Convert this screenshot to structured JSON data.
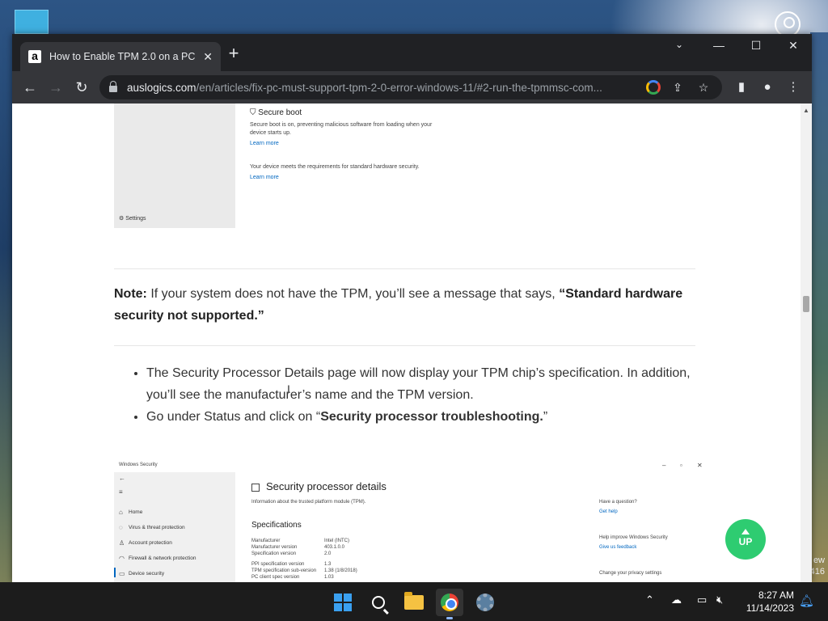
{
  "browser": {
    "tab_title": "How to Enable TPM 2.0 on a PC",
    "url_host": "auslogics.com",
    "url_path": "/en/articles/fix-pc-must-support-tpm-2-0-error-windows-11/#2-run-the-tpmmsc-com..."
  },
  "screenshot1": {
    "title": "Secure boot",
    "desc": "Secure boot is on, preventing malicious software from loading when your device starts up.",
    "link1": "Learn more",
    "status": "Your device meets the requirements for standard hardware security.",
    "link2": "Learn more",
    "settings": "Settings"
  },
  "note": {
    "label": "Note:",
    "text": "If your system does not have the TPM, you’ll see a message that says,",
    "quote": "“Standard hardware security not supported.”"
  },
  "bullets": {
    "item1": "The Security Processor Details page will now display your TPM chip’s specification. In addition, you’ll see the manufacturer’s name and the TPM version.",
    "item2_prefix": "Go under Status and click on “",
    "item2_bold": "Security processor troubleshooting.",
    "item2_suffix": "”"
  },
  "screenshot2": {
    "app_title": "Windows Security",
    "heading": "Security processor details",
    "subheading": "Information about the trusted platform module (TPM).",
    "nav": [
      "Home",
      "Virus & threat protection",
      "Account protection",
      "Firewall & network protection",
      "Device security"
    ],
    "spec_heading": "Specifications",
    "specs": [
      {
        "k": "Manufacturer",
        "v": "Intel (INTC)"
      },
      {
        "k": "Manufacturer version",
        "v": "403.1.0.0"
      },
      {
        "k": "Specification version",
        "v": "2.0"
      },
      {
        "k": "PPI specification version",
        "v": "1.3"
      },
      {
        "k": "TPM specification sub-version",
        "v": "1.38 (1/8/2018)"
      },
      {
        "k": "PC client spec version",
        "v": "1.03"
      }
    ],
    "question": "Have a question?",
    "get_help": "Get help",
    "improve": "Help improve Windows Security",
    "feedback": "Give us feedback",
    "privacy": "Change your privacy settings"
  },
  "up_button": "UP",
  "taskbar": {
    "time": "8:27 AM",
    "date": "11/14/2023"
  },
  "edge_text": "ew\n416"
}
